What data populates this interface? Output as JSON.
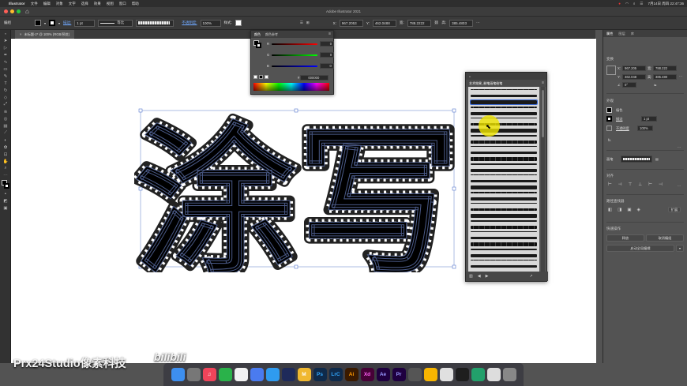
{
  "menubar": {
    "app": "Illustrator",
    "items": [
      "文件",
      "编辑",
      "对象",
      "文字",
      "选择",
      "效果",
      "视图",
      "窗口",
      "帮助"
    ],
    "clock": "7月14日 周四 22:47:36"
  },
  "window": {
    "title": "Adobe Illustrator 2021"
  },
  "control": {
    "mode": "编组",
    "stroke_label": "描边:",
    "stroke_value": "1 pt",
    "brush_label": "等比",
    "opacity_label": "不透明度:",
    "opacity_value": "100%",
    "style_label": "样式:",
    "x_label": "X:",
    "x_value": "967.2053",
    "y_label": "Y:",
    "y_value": "462.0488",
    "w_label": "宽:",
    "w_value": "788.2222",
    "h_label": "高:",
    "h_value": "385.4803"
  },
  "doc_tab": {
    "label": "未标题-2* @ 100% (RGB/预览)"
  },
  "artwork": {
    "text": "涂写"
  },
  "color_panel": {
    "tab_color": "颜色",
    "tab_guide": "颜色参考",
    "r_label": "R",
    "r_value": "0",
    "g_label": "G",
    "g_value": "0",
    "b_label": "B",
    "b_value": "0",
    "hex_label": "#",
    "hex_value": "000000"
  },
  "brush_panel": {
    "title": "艺术效果_粉笔画笔绘笔"
  },
  "properties": {
    "tabs": [
      "属性",
      "图层",
      "库"
    ],
    "transform_title": "变换",
    "x_label": "X:",
    "x_value": "967.205",
    "y_label": "Y:",
    "y_value": "462.048",
    "w_label": "宽:",
    "w_value": "788.222",
    "h_label": "高:",
    "h_value": "385.480",
    "angle_value": "0°",
    "appearance_title": "外观",
    "fill_label": "填色",
    "stroke_label": "描边",
    "stroke_value": "1 pt",
    "opacity_label": "不透明度",
    "opacity_value": "100%",
    "fx_label": "fx.",
    "brush_label": "画笔",
    "align_title": "对齐",
    "pathfinder_title": "路径查找器",
    "expand_label": "扩展",
    "quick_title": "快速操作",
    "ungroup_label": "取消编组",
    "release_label": "释放",
    "global_edit_label": "启动全局编辑"
  },
  "dock": {
    "apps": [
      {
        "name": "finder",
        "label": "",
        "color": "#3d8ff0"
      },
      {
        "name": "launchpad",
        "label": "",
        "color": "#777"
      },
      {
        "name": "music",
        "label": "♫",
        "color": "#f0445a"
      },
      {
        "name": "wechat",
        "label": "",
        "color": "#2ab24a"
      },
      {
        "name": "qq",
        "label": "",
        "color": "#f2f2f2"
      },
      {
        "name": "feishu",
        "label": "",
        "color": "#4a7bf0"
      },
      {
        "name": "browser",
        "label": "",
        "color": "#2f9bf0"
      },
      {
        "name": "cinema4d",
        "label": "",
        "color": "#1e2a5a"
      },
      {
        "name": "miro",
        "label": "M",
        "color": "#f0b830"
      },
      {
        "name": "photoshop",
        "label": "Ps",
        "color": "#0f2a4a"
      },
      {
        "name": "lightroom",
        "label": "LrC",
        "color": "#0f2a4a"
      },
      {
        "name": "illustrator",
        "label": "Ai",
        "color": "#3a1a00"
      },
      {
        "name": "xd",
        "label": "Xd",
        "color": "#470137"
      },
      {
        "name": "aftereffects",
        "label": "Ae",
        "color": "#1f0040"
      },
      {
        "name": "premiere",
        "label": "Pr",
        "color": "#1f0040"
      },
      {
        "name": "finalcut",
        "label": "",
        "color": "#555"
      },
      {
        "name": "sketch",
        "label": "",
        "color": "#f7b500"
      },
      {
        "name": "chrome",
        "label": "",
        "color": "#e0e0e0"
      },
      {
        "name": "figma",
        "label": "",
        "color": "#1e1e1e"
      },
      {
        "name": "app-green",
        "label": "",
        "color": "#22a06b"
      },
      {
        "name": "screen",
        "label": "",
        "color": "#ddd"
      },
      {
        "name": "trash",
        "label": "",
        "color": "#888"
      }
    ]
  },
  "watermark": {
    "text": "Prx24Studio像素科技",
    "logo": "bilibili"
  }
}
